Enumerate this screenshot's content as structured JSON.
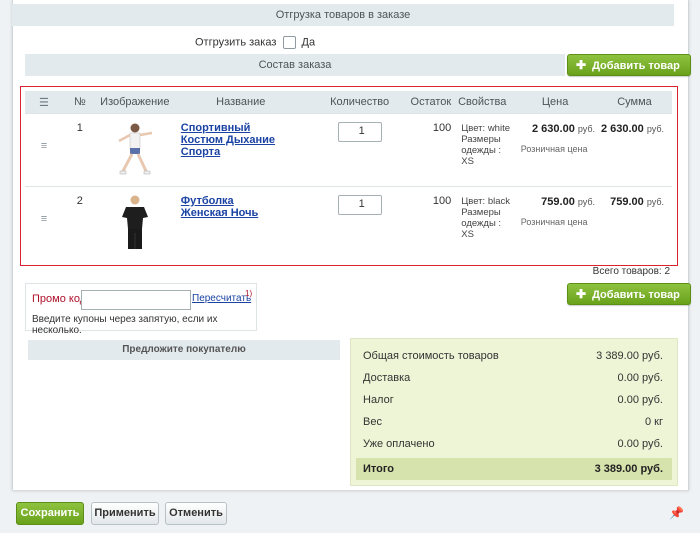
{
  "shipment": {
    "header": "Отгрузка товаров в заказе",
    "ship_label": "Отгрузить заказ",
    "ship_yes": "Да"
  },
  "order": {
    "header": "Состав заказа",
    "add_product": "Добавить товар"
  },
  "table": {
    "columns": {
      "num": "№",
      "image": "Изображение",
      "name": "Название",
      "quantity": "Количество",
      "stock": "Остаток",
      "props": "Свойства",
      "price": "Цена",
      "sum": "Сумма"
    },
    "rows": [
      {
        "num": "1",
        "name": "Спортивный Костюм Дыхание Спорта",
        "quantity": "1",
        "stock": "100",
        "prop1": "Цвет: white",
        "prop2": "Размеры",
        "prop3": "одежды : XS",
        "price": "2 630.00",
        "price_cur": "руб.",
        "price_note": "Розничная цена",
        "sum": "2 630.00",
        "sum_cur": "руб."
      },
      {
        "num": "2",
        "name": "Футболка Женская Ночь",
        "quantity": "1",
        "stock": "100",
        "prop1": "Цвет: black",
        "prop2": "Размеры",
        "prop3": "одежды : XS",
        "price": "759.00",
        "price_cur": "руб.",
        "price_note": "Розничная цена",
        "sum": "759.00",
        "sum_cur": "руб."
      }
    ],
    "total_items": "Всего товаров: 2"
  },
  "promo": {
    "label": "Промо код:",
    "value": "",
    "recalc": "Пересчитать",
    "footnote": "1)",
    "hint": "Введите купоны через запятую, если их несколько."
  },
  "add_product_bottom": "Добавить товар",
  "suggest": "Предложите покупателю",
  "totals": {
    "goods_label": "Общая стоимость товаров",
    "goods_value": "3 389.00 руб.",
    "delivery_label": "Доставка",
    "delivery_value": "0.00 руб.",
    "tax_label": "Налог",
    "tax_value": "0.00 руб.",
    "weight_label": "Вес",
    "weight_value": "0 кг",
    "paid_label": "Уже оплачено",
    "paid_value": "0.00 руб.",
    "grand_label": "Итого",
    "grand_value": "3 389.00 руб."
  },
  "footer": {
    "save": "Сохранить",
    "apply": "Применить",
    "cancel": "Отменить"
  },
  "colors": {
    "accent_green": "#6aa21c",
    "link_blue": "#1a43a3",
    "highlight_red": "#d9232d",
    "totals_bg": "#eef4d6"
  }
}
